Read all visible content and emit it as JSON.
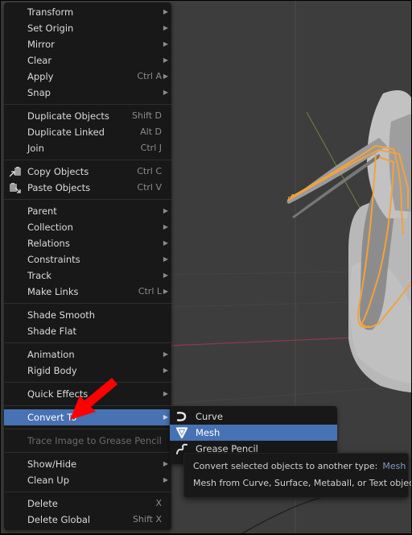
{
  "viewport": {
    "background": "#3d3d3d",
    "selection_color": "#f3a23c",
    "x_axis_color": "#8e3a4a",
    "y_axis_color": "#6b7a3a"
  },
  "main_menu": {
    "groups": [
      [
        {
          "label": "Transform",
          "shortcut": "",
          "submenu": true
        },
        {
          "label": "Set Origin",
          "shortcut": "",
          "submenu": true
        },
        {
          "label": "Mirror",
          "shortcut": "",
          "submenu": true
        },
        {
          "label": "Clear",
          "shortcut": "",
          "submenu": true
        },
        {
          "label": "Apply",
          "shortcut": "Ctrl A",
          "submenu": true
        },
        {
          "label": "Snap",
          "shortcut": "",
          "submenu": true
        }
      ],
      [
        {
          "label": "Duplicate Objects",
          "shortcut": "Shift D",
          "submenu": false
        },
        {
          "label": "Duplicate Linked",
          "shortcut": "Alt D",
          "submenu": false
        },
        {
          "label": "Join",
          "shortcut": "Ctrl J",
          "submenu": false
        }
      ],
      [
        {
          "label": "Copy Objects",
          "shortcut": "Ctrl C",
          "submenu": false,
          "icon": "copy-icon"
        },
        {
          "label": "Paste Objects",
          "shortcut": "Ctrl V",
          "submenu": false,
          "icon": "paste-icon"
        }
      ],
      [
        {
          "label": "Parent",
          "shortcut": "",
          "submenu": true
        },
        {
          "label": "Collection",
          "shortcut": "",
          "submenu": true
        },
        {
          "label": "Relations",
          "shortcut": "",
          "submenu": true
        },
        {
          "label": "Constraints",
          "shortcut": "",
          "submenu": true
        },
        {
          "label": "Track",
          "shortcut": "",
          "submenu": true
        },
        {
          "label": "Make Links",
          "shortcut": "Ctrl L",
          "submenu": true
        }
      ],
      [
        {
          "label": "Shade Smooth",
          "shortcut": "",
          "submenu": false
        },
        {
          "label": "Shade Flat",
          "shortcut": "",
          "submenu": false
        }
      ],
      [
        {
          "label": "Animation",
          "shortcut": "",
          "submenu": true
        },
        {
          "label": "Rigid Body",
          "shortcut": "",
          "submenu": true
        }
      ],
      [
        {
          "label": "Quick Effects",
          "shortcut": "",
          "submenu": true
        }
      ],
      [
        {
          "label": "Convert To",
          "shortcut": "",
          "submenu": true,
          "active": true
        }
      ],
      [
        {
          "label": "Trace Image to Grease Pencil",
          "shortcut": "",
          "submenu": false,
          "disabled": true
        }
      ],
      [
        {
          "label": "Show/Hide",
          "shortcut": "",
          "submenu": true
        },
        {
          "label": "Clean Up",
          "shortcut": "",
          "submenu": true
        }
      ],
      [
        {
          "label": "Delete",
          "shortcut": "X",
          "submenu": false
        },
        {
          "label": "Delete Global",
          "shortcut": "Shift X",
          "submenu": false
        }
      ]
    ]
  },
  "convert_submenu": {
    "items": [
      {
        "label": "Curve",
        "icon": "curve-icon"
      },
      {
        "label": "Mesh",
        "icon": "mesh-icon",
        "active": true
      },
      {
        "label": "Grease Pencil",
        "icon": "grease-pencil-icon"
      }
    ]
  },
  "tooltip": {
    "title": "Convert selected objects to another type:",
    "value": "Mesh",
    "description": "Mesh from Curve, Surface, Metaball, or Text objects"
  },
  "annotation": {
    "arrow_color": "#ff0000",
    "target": "Convert To"
  }
}
